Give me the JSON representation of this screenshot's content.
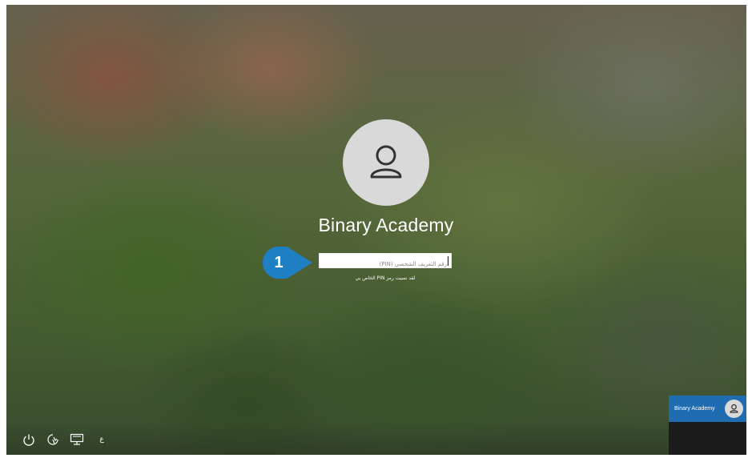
{
  "login": {
    "username": "Binary Academy",
    "pin_placeholder": "رقم التعريف الشخصي (PIN)",
    "pin_value": "",
    "forgot_pin": "لقد نسيت رمز PIN الخاص بي"
  },
  "callout": {
    "number": "1",
    "color": "#1f7fc4"
  },
  "bottom_left": {
    "icons": [
      "power-icon",
      "ease-of-access-icon",
      "network-icon"
    ],
    "language": "ع"
  },
  "user_tile": {
    "name": "Binary Academy",
    "color": "#1f6db0"
  }
}
